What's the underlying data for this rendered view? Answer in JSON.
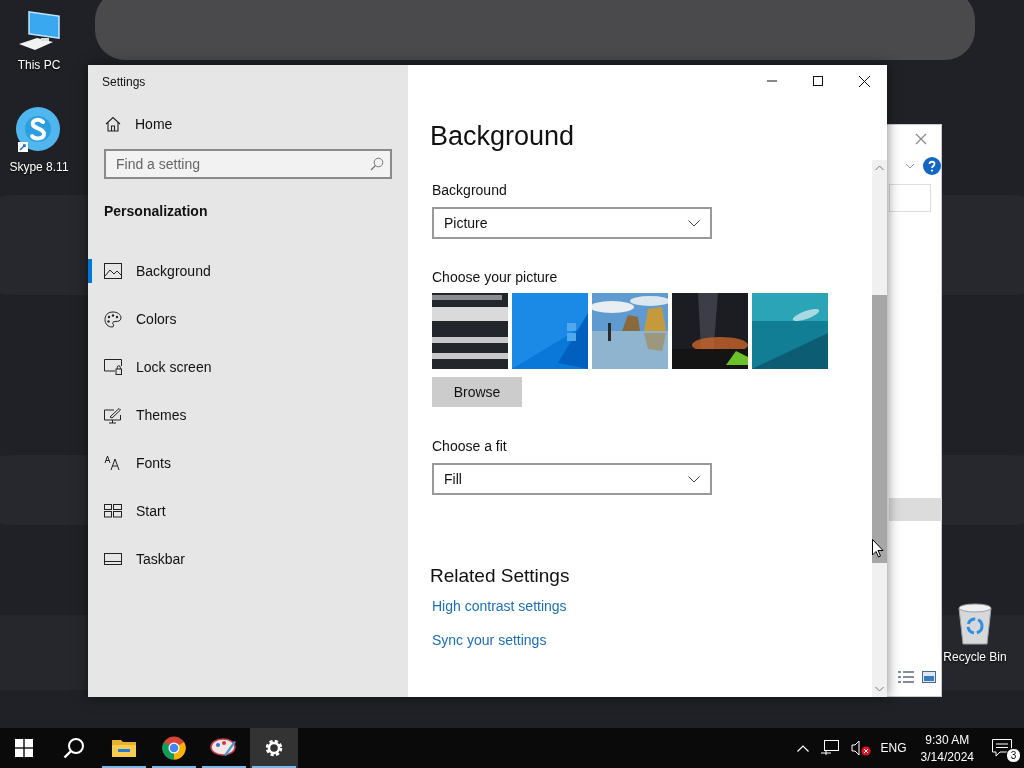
{
  "desktop_icons": [
    {
      "label": "This PC"
    },
    {
      "label": "Skype 8.11"
    },
    {
      "label": "Recycle Bin"
    }
  ],
  "window": {
    "title": "Settings"
  },
  "sidebar": {
    "home": "Home",
    "search": {
      "placeholder": "Find a setting"
    },
    "section": "Personalization",
    "items": [
      {
        "label": "Background",
        "selected": true
      },
      {
        "label": "Colors",
        "selected": false
      },
      {
        "label": "Lock screen",
        "selected": false
      },
      {
        "label": "Themes",
        "selected": false
      },
      {
        "label": "Fonts",
        "selected": false
      },
      {
        "label": "Start",
        "selected": false
      },
      {
        "label": "Taskbar",
        "selected": false
      }
    ]
  },
  "content": {
    "title": "Background",
    "background_field": {
      "label": "Background",
      "value": "Picture"
    },
    "pictures_label": "Choose your picture",
    "pictures": [
      {
        "kind": "picture"
      },
      {
        "kind": "picture"
      },
      {
        "kind": "picture"
      },
      {
        "kind": "picture"
      },
      {
        "kind": "picture"
      }
    ],
    "browse_button": "Browse",
    "fit_field": {
      "label": "Choose a fit",
      "value": "Fill"
    },
    "related_heading": "Related Settings",
    "links": [
      "High contrast settings",
      "Sync your settings"
    ]
  },
  "taskbar": {
    "apps": [
      {
        "running": true,
        "selected": false
      },
      {
        "running": true,
        "selected": false
      },
      {
        "running": true,
        "selected": false
      },
      {
        "running": true,
        "selected": true
      }
    ],
    "tray": {
      "volume_muted": true,
      "language": "ENG",
      "time": "9:30 AM",
      "date": "3/14/2024",
      "notifications": "3"
    }
  }
}
